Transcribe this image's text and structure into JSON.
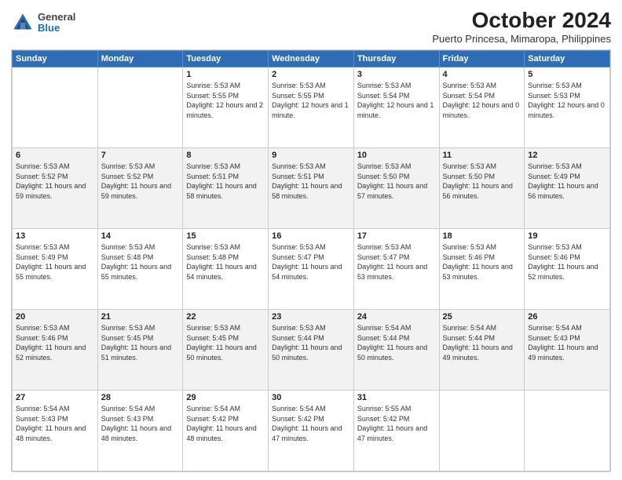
{
  "header": {
    "logo": {
      "line1": "General",
      "line2": "Blue"
    },
    "title": "October 2024",
    "subtitle": "Puerto Princesa, Mimaropa, Philippines"
  },
  "weekdays": [
    "Sunday",
    "Monday",
    "Tuesday",
    "Wednesday",
    "Thursday",
    "Friday",
    "Saturday"
  ],
  "weeks": [
    [
      {
        "day": "",
        "sunrise": "",
        "sunset": "",
        "daylight": "",
        "empty": true
      },
      {
        "day": "",
        "sunrise": "",
        "sunset": "",
        "daylight": "",
        "empty": true
      },
      {
        "day": "1",
        "sunrise": "Sunrise: 5:53 AM",
        "sunset": "Sunset: 5:55 PM",
        "daylight": "Daylight: 12 hours and 2 minutes."
      },
      {
        "day": "2",
        "sunrise": "Sunrise: 5:53 AM",
        "sunset": "Sunset: 5:55 PM",
        "daylight": "Daylight: 12 hours and 1 minute."
      },
      {
        "day": "3",
        "sunrise": "Sunrise: 5:53 AM",
        "sunset": "Sunset: 5:54 PM",
        "daylight": "Daylight: 12 hours and 1 minute."
      },
      {
        "day": "4",
        "sunrise": "Sunrise: 5:53 AM",
        "sunset": "Sunset: 5:54 PM",
        "daylight": "Daylight: 12 hours and 0 minutes."
      },
      {
        "day": "5",
        "sunrise": "Sunrise: 5:53 AM",
        "sunset": "Sunset: 5:53 PM",
        "daylight": "Daylight: 12 hours and 0 minutes."
      }
    ],
    [
      {
        "day": "6",
        "sunrise": "Sunrise: 5:53 AM",
        "sunset": "Sunset: 5:52 PM",
        "daylight": "Daylight: 11 hours and 59 minutes."
      },
      {
        "day": "7",
        "sunrise": "Sunrise: 5:53 AM",
        "sunset": "Sunset: 5:52 PM",
        "daylight": "Daylight: 11 hours and 59 minutes."
      },
      {
        "day": "8",
        "sunrise": "Sunrise: 5:53 AM",
        "sunset": "Sunset: 5:51 PM",
        "daylight": "Daylight: 11 hours and 58 minutes."
      },
      {
        "day": "9",
        "sunrise": "Sunrise: 5:53 AM",
        "sunset": "Sunset: 5:51 PM",
        "daylight": "Daylight: 11 hours and 58 minutes."
      },
      {
        "day": "10",
        "sunrise": "Sunrise: 5:53 AM",
        "sunset": "Sunset: 5:50 PM",
        "daylight": "Daylight: 11 hours and 57 minutes."
      },
      {
        "day": "11",
        "sunrise": "Sunrise: 5:53 AM",
        "sunset": "Sunset: 5:50 PM",
        "daylight": "Daylight: 11 hours and 56 minutes."
      },
      {
        "day": "12",
        "sunrise": "Sunrise: 5:53 AM",
        "sunset": "Sunset: 5:49 PM",
        "daylight": "Daylight: 11 hours and 56 minutes."
      }
    ],
    [
      {
        "day": "13",
        "sunrise": "Sunrise: 5:53 AM",
        "sunset": "Sunset: 5:49 PM",
        "daylight": "Daylight: 11 hours and 55 minutes."
      },
      {
        "day": "14",
        "sunrise": "Sunrise: 5:53 AM",
        "sunset": "Sunset: 5:48 PM",
        "daylight": "Daylight: 11 hours and 55 minutes."
      },
      {
        "day": "15",
        "sunrise": "Sunrise: 5:53 AM",
        "sunset": "Sunset: 5:48 PM",
        "daylight": "Daylight: 11 hours and 54 minutes."
      },
      {
        "day": "16",
        "sunrise": "Sunrise: 5:53 AM",
        "sunset": "Sunset: 5:47 PM",
        "daylight": "Daylight: 11 hours and 54 minutes."
      },
      {
        "day": "17",
        "sunrise": "Sunrise: 5:53 AM",
        "sunset": "Sunset: 5:47 PM",
        "daylight": "Daylight: 11 hours and 53 minutes."
      },
      {
        "day": "18",
        "sunrise": "Sunrise: 5:53 AM",
        "sunset": "Sunset: 5:46 PM",
        "daylight": "Daylight: 11 hours and 53 minutes."
      },
      {
        "day": "19",
        "sunrise": "Sunrise: 5:53 AM",
        "sunset": "Sunset: 5:46 PM",
        "daylight": "Daylight: 11 hours and 52 minutes."
      }
    ],
    [
      {
        "day": "20",
        "sunrise": "Sunrise: 5:53 AM",
        "sunset": "Sunset: 5:46 PM",
        "daylight": "Daylight: 11 hours and 52 minutes."
      },
      {
        "day": "21",
        "sunrise": "Sunrise: 5:53 AM",
        "sunset": "Sunset: 5:45 PM",
        "daylight": "Daylight: 11 hours and 51 minutes."
      },
      {
        "day": "22",
        "sunrise": "Sunrise: 5:53 AM",
        "sunset": "Sunset: 5:45 PM",
        "daylight": "Daylight: 11 hours and 50 minutes."
      },
      {
        "day": "23",
        "sunrise": "Sunrise: 5:53 AM",
        "sunset": "Sunset: 5:44 PM",
        "daylight": "Daylight: 11 hours and 50 minutes."
      },
      {
        "day": "24",
        "sunrise": "Sunrise: 5:54 AM",
        "sunset": "Sunset: 5:44 PM",
        "daylight": "Daylight: 11 hours and 50 minutes."
      },
      {
        "day": "25",
        "sunrise": "Sunrise: 5:54 AM",
        "sunset": "Sunset: 5:44 PM",
        "daylight": "Daylight: 11 hours and 49 minutes."
      },
      {
        "day": "26",
        "sunrise": "Sunrise: 5:54 AM",
        "sunset": "Sunset: 5:43 PM",
        "daylight": "Daylight: 11 hours and 49 minutes."
      }
    ],
    [
      {
        "day": "27",
        "sunrise": "Sunrise: 5:54 AM",
        "sunset": "Sunset: 5:43 PM",
        "daylight": "Daylight: 11 hours and 48 minutes."
      },
      {
        "day": "28",
        "sunrise": "Sunrise: 5:54 AM",
        "sunset": "Sunset: 5:43 PM",
        "daylight": "Daylight: 11 hours and 48 minutes."
      },
      {
        "day": "29",
        "sunrise": "Sunrise: 5:54 AM",
        "sunset": "Sunset: 5:42 PM",
        "daylight": "Daylight: 11 hours and 48 minutes."
      },
      {
        "day": "30",
        "sunrise": "Sunrise: 5:54 AM",
        "sunset": "Sunset: 5:42 PM",
        "daylight": "Daylight: 11 hours and 47 minutes."
      },
      {
        "day": "31",
        "sunrise": "Sunrise: 5:55 AM",
        "sunset": "Sunset: 5:42 PM",
        "daylight": "Daylight: 11 hours and 47 minutes."
      },
      {
        "day": "",
        "sunrise": "",
        "sunset": "",
        "daylight": "",
        "empty": true
      },
      {
        "day": "",
        "sunrise": "",
        "sunset": "",
        "daylight": "",
        "empty": true
      }
    ]
  ]
}
